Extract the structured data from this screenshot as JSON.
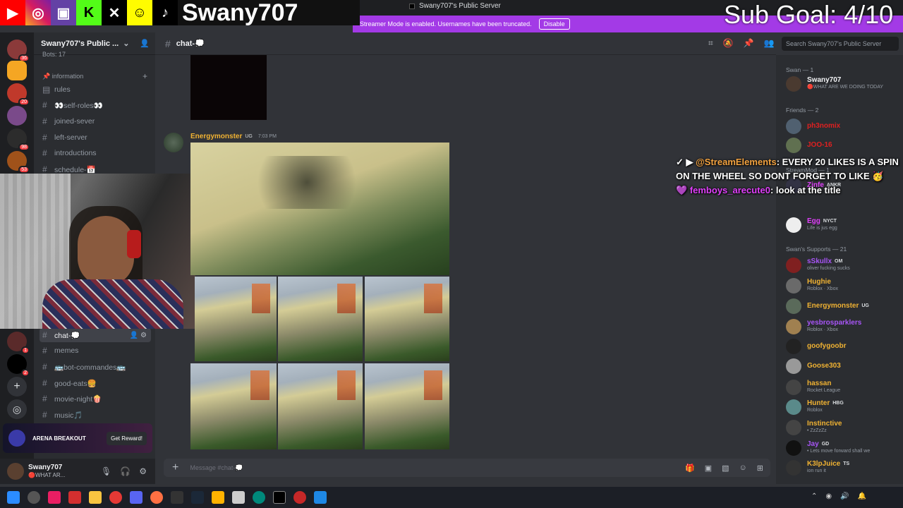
{
  "window": {
    "title": "Swany707's Public Server"
  },
  "streamer_bar": {
    "text": "Streamer Mode is enabled. Usernames have been truncated.",
    "disable_label": "Disable"
  },
  "overlay": {
    "handle": "Swany707",
    "sub_goal": "Sub Goal: 4/10"
  },
  "server": {
    "name": "Swany707's Public ...",
    "bots_label": "Bots: 17"
  },
  "rail_badges": [
    "36",
    "20",
    "98",
    "53",
    "1",
    "2"
  ],
  "channels": {
    "category": "information",
    "top": [
      "rules",
      "👀self-roles👀",
      "joined-sever",
      "left-server",
      "introductions",
      "schedule-📅"
    ],
    "bottom_active": "chat-💭",
    "bottom": [
      "memes",
      "🚌bot-commandes🚌",
      "good-eats🍔",
      "movie-night🍿",
      "music🎵"
    ]
  },
  "ad": {
    "logo": "ARENA BREAKOUT",
    "button": "Get Reward!"
  },
  "user": {
    "name": "Swany707",
    "status": "🔴WHAT AR..."
  },
  "chat": {
    "channel": "chat-💭",
    "placeholder": "Message #chat-💭",
    "search_placeholder": "Search Swany707's Public Server"
  },
  "message": {
    "author": "Energymonster",
    "tag": "UG",
    "time": "7:03 PM"
  },
  "stream_elements": {
    "line1_name": "@StreamElements",
    "line1_text": ": EVERY 20 LIKES IS A SPIN ON THE WHEEL SO DONT FORGET TO LIKE",
    "line2_name": "femboys_arecute0",
    "line2_text": ": look at the title"
  },
  "members": {
    "groups": [
      "Swan — 1",
      "Friends — 2",
      "StreamMod — 1",
      "Swan's Supports — 21"
    ],
    "list": [
      {
        "name": "Swany707",
        "status": "🔴WHAT ARE WE DOING TODAY",
        "color": "#f2f3f5",
        "tag": ""
      },
      {
        "name": "ph3nomix",
        "status": "",
        "color": "#e02020",
        "tag": ""
      },
      {
        "name": "JOO-16",
        "status": "",
        "color": "#e02020",
        "tag": ""
      },
      {
        "name": "Zinfe",
        "status": "",
        "color": "#e040fb",
        "tag": "ANKR"
      },
      {
        "name": "Egg",
        "status": "Life is jus egg",
        "color": "#e040fb",
        "tag": "NYCT"
      },
      {
        "name": "sSkullx",
        "status": "oliver fucking sucks",
        "color": "#a855f7",
        "tag": "OM"
      },
      {
        "name": "Hughie",
        "status": "Roblox · Xbox",
        "color": "#f0b232",
        "tag": ""
      },
      {
        "name": "Energymonster",
        "status": "",
        "color": "#f0b232",
        "tag": "UG"
      },
      {
        "name": "yesbrosparklers",
        "status": "Roblox · Xbox",
        "color": "#a855f7",
        "tag": ""
      },
      {
        "name": "goofygoobr",
        "status": "",
        "color": "#f0b232",
        "tag": ""
      },
      {
        "name": "Goose303",
        "status": "",
        "color": "#f0b232",
        "tag": ""
      },
      {
        "name": "hassan",
        "status": "Rocket League",
        "color": "#f0b232",
        "tag": ""
      },
      {
        "name": "Hunter",
        "status": "Roblox",
        "color": "#f0b232",
        "tag": "HBG"
      },
      {
        "name": "Instinctive",
        "status": "• ZzZzZz",
        "color": "#f0b232",
        "tag": ""
      },
      {
        "name": "Jay",
        "status": "• Lets move forward shall we",
        "color": "#a855f7",
        "tag": "GD"
      },
      {
        "name": "K3lpJuice",
        "status": "ion run it",
        "color": "#f0b232",
        "tag": "TS"
      }
    ]
  },
  "icons": [
    "youtube-icon",
    "instagram-icon",
    "twitch-icon",
    "kick-icon",
    "x-icon",
    "snapchat-icon",
    "tiktok-icon"
  ]
}
